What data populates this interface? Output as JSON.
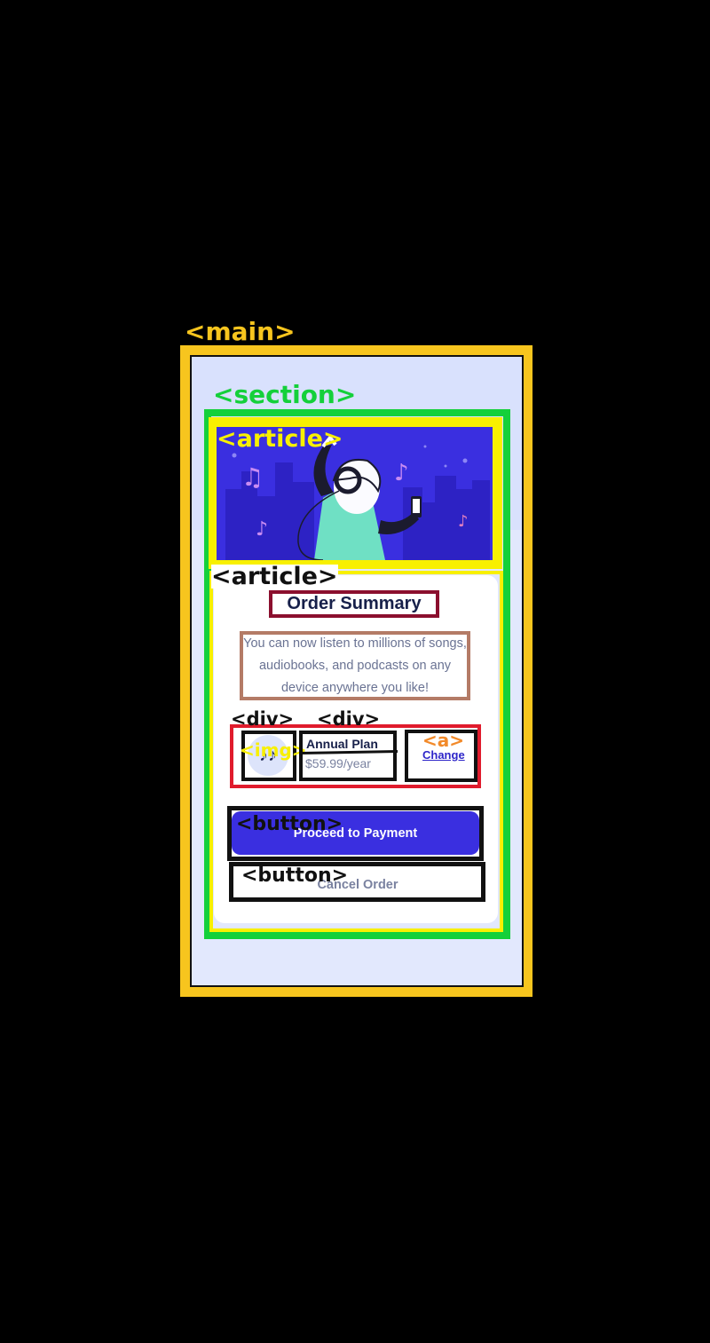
{
  "annotations": {
    "main": "<main>",
    "section": "<section>",
    "article_hero": "<article>",
    "article_card": "<article>",
    "div_1": "<div>",
    "div_2": "<div>",
    "img": "<img>",
    "a": "<a>",
    "button_1": "<button>",
    "button_2": "<button>"
  },
  "hero": {
    "background": "#3a2fe0",
    "icons": [
      "music-note-icon",
      "headphones-icon",
      "phone-icon"
    ]
  },
  "card": {
    "title": "Order Summary",
    "description": "You can now listen to millions of songs, audiobooks, and podcasts on any device anywhere you like!"
  },
  "plan": {
    "icon": "music-note-icon",
    "icon_glyph": "♪♪",
    "name": "Annual Plan",
    "price": "$59.99/year",
    "change_label": "Change"
  },
  "actions": {
    "proceed_label": "Proceed to Payment",
    "cancel_label": "Cancel Order"
  },
  "colors": {
    "accent": "#3a2fe0",
    "screen_bg": "#d9e1fd",
    "annotation_main": "#f7c51e",
    "annotation_section": "#14d03a",
    "annotation_article": "#f8f000",
    "annotation_row": "#e01b2c",
    "annotation_title": "#8b0f2e",
    "annotation_desc": "#b47b66"
  }
}
